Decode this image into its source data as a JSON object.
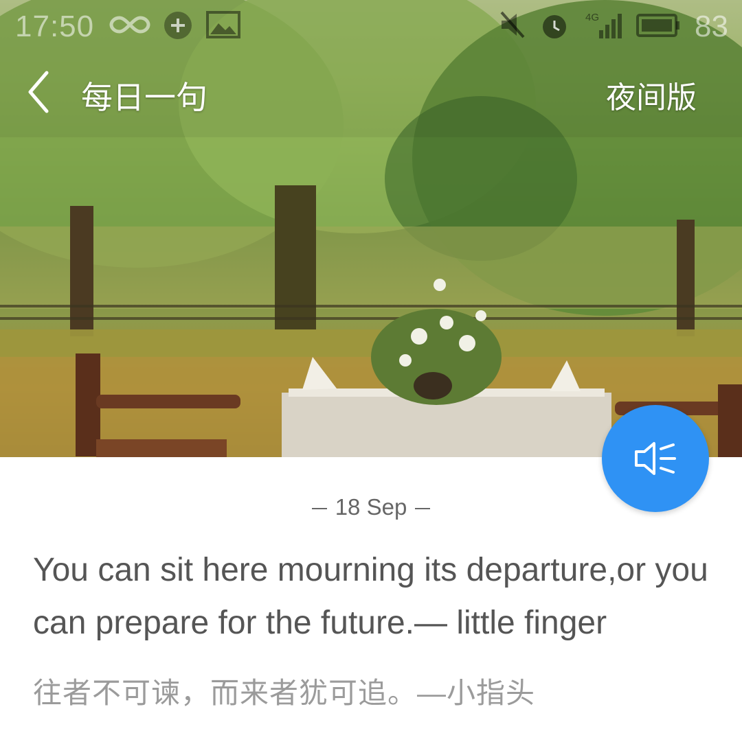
{
  "status_bar": {
    "time": "17:50",
    "battery_level": "83",
    "icons": [
      "infinity-icon",
      "sync-icon",
      "image-icon",
      "mute-icon",
      "alarm-icon",
      "signal-4g-icon",
      "battery-icon"
    ],
    "network_label": "4G"
  },
  "header": {
    "title": "每日一句",
    "night_mode_label": "夜间版"
  },
  "hero": {
    "image": "garden-table-photo",
    "colors": {
      "fab": "#2f92f4"
    }
  },
  "content": {
    "date": "18 Sep",
    "quote_en": "You can sit here mourning its departure,or you can prepare for the future.— little finger",
    "quote_zh": "往者不可谏，而来者犹可追。—小指头"
  }
}
